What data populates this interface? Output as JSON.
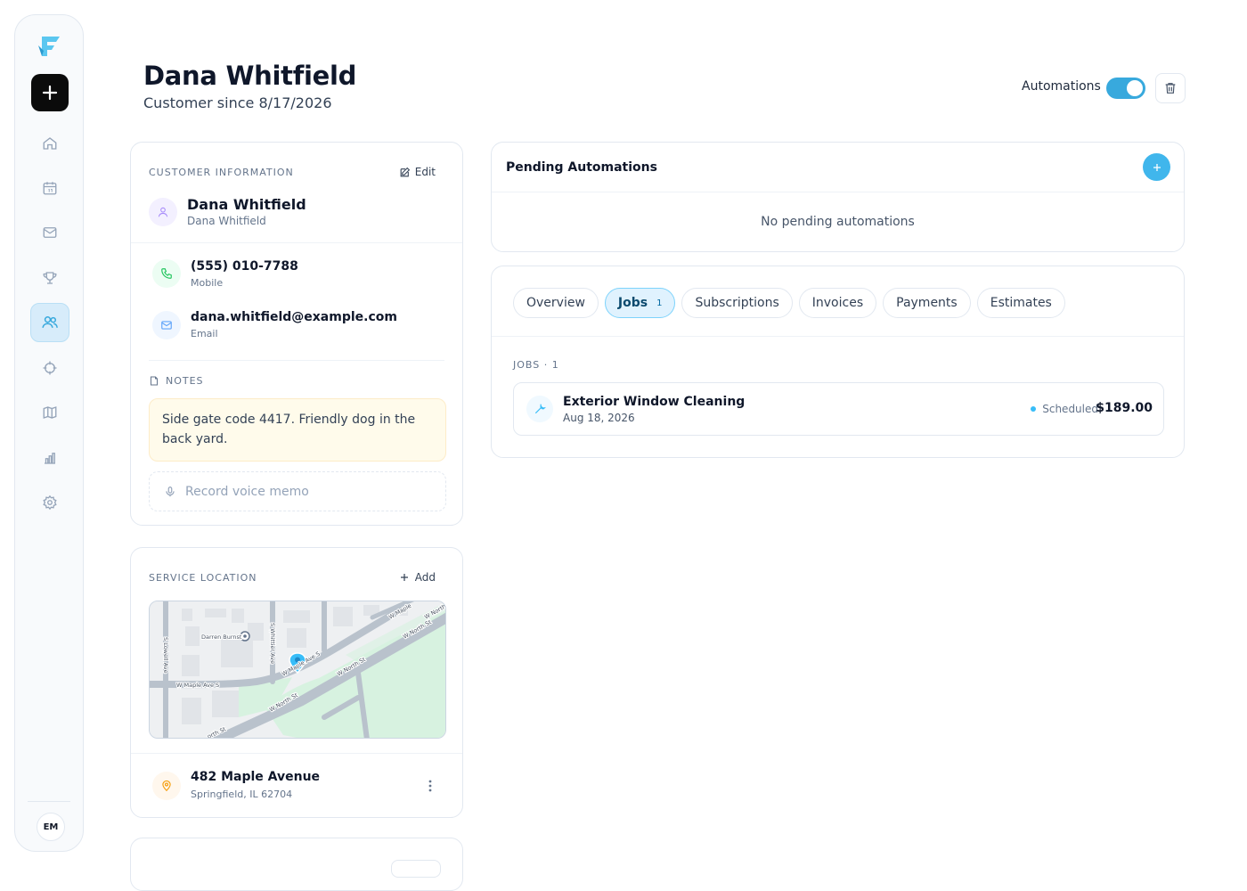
{
  "header": {
    "title": "Dana Whitfield",
    "subtitle": "Customer since 8/17/2026",
    "automations_label": "Automations",
    "automations_on": true
  },
  "sidebar": {
    "avatar_initials": "EM",
    "items": [
      "home-icon",
      "calendar-icon",
      "mail-icon",
      "trophy-icon",
      "users-icon",
      "crosshair-icon",
      "map-icon",
      "bar-chart-icon",
      "gear-icon"
    ],
    "active": "users-icon"
  },
  "customer_info": {
    "section_label": "CUSTOMER INFORMATION",
    "edit_label": "Edit",
    "name": "Dana Whitfield",
    "name_sub": "Dana Whitfield",
    "phone": "(555) 010-7788",
    "phone_type": "Mobile",
    "email": "dana.whitfield@example.com",
    "email_type": "Email",
    "notes_label": "NOTES",
    "notes": "Side gate code 4417. Friendly dog in the back yard.",
    "memo_label": "Record voice memo"
  },
  "service_location": {
    "section_label": "SERVICE LOCATION",
    "add_label": "Add",
    "map_labels": [
      "Darren Burnst",
      "S Lowell Ave",
      "S Whittier Ave",
      "W Maple Ave S",
      "W Maple Ave S",
      "W North St",
      "W North St",
      "W North St",
      "W Maple",
      "W North St",
      "orth St"
    ],
    "address": "482 Maple Avenue",
    "city": "Springfield, IL 62704"
  },
  "pending_automations": {
    "title": "Pending Automations",
    "empty": "No pending automations"
  },
  "tabs": [
    {
      "label": "Overview"
    },
    {
      "label": "Jobs",
      "count": "1"
    },
    {
      "label": "Subscriptions"
    },
    {
      "label": "Invoices"
    },
    {
      "label": "Payments"
    },
    {
      "label": "Estimates"
    }
  ],
  "active_tab": "Jobs",
  "jobs": {
    "label": "JOBS · 1",
    "items": [
      {
        "title": "Exterior Window Cleaning",
        "date": "Aug 18, 2026",
        "status": "Scheduled",
        "price": "$189.00"
      }
    ]
  },
  "colors": {
    "accent": "#38a9dd",
    "active_tab_bg": "#e0f2fe",
    "notes_bg": "#fffbeb",
    "park_green": "#d7f2e0"
  }
}
